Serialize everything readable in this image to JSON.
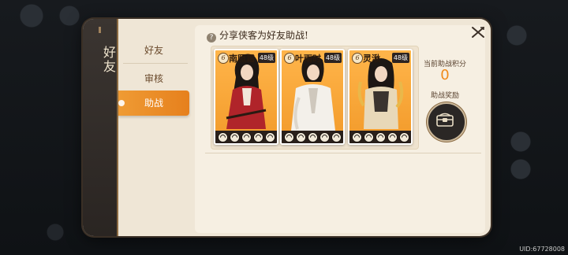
{
  "panel": {
    "vertical_title": "好友"
  },
  "tabs": [
    {
      "label": "好友"
    },
    {
      "label": "审核"
    },
    {
      "label": "助战",
      "active": true
    }
  ],
  "share_text": "分享侠客为好友助战!",
  "heroes": [
    {
      "name": "南照霜",
      "level": "48级",
      "star": "6",
      "stamina_pips": 5
    },
    {
      "name": "叶雨时",
      "level": "48级",
      "star": "6",
      "stamina_pips": 5
    },
    {
      "name": "灵湫",
      "level": "48级",
      "star": "6",
      "stamina_pips": 5
    }
  ],
  "points": {
    "label": "当前助战积分",
    "value": "0"
  },
  "reward": {
    "label": "助战奖励",
    "icon": "chest-icon"
  },
  "uid_text": "UID:67728008",
  "colors": {
    "accent": "#f08a1a",
    "tab_active": "#ea8b26",
    "card_bg": "#f7a53a"
  }
}
